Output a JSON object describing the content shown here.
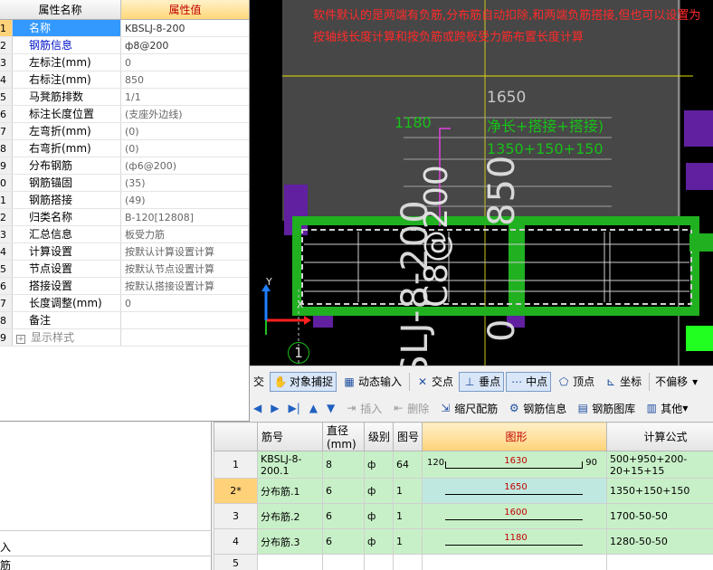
{
  "properties_panel": {
    "header_name": "属性名称",
    "header_value": "属性值",
    "rows": [
      {
        "num": "1",
        "name": "名称",
        "value": "KBSLJ-8-200",
        "style": "sel"
      },
      {
        "num": "2",
        "name": "钢筋信息",
        "value": "ф8@200",
        "style": "blue"
      },
      {
        "num": "3",
        "name": "左标注(mm)",
        "value": "0",
        "style": ""
      },
      {
        "num": "4",
        "name": "右标注(mm)",
        "value": "850",
        "style": ""
      },
      {
        "num": "5",
        "name": "马凳筋排数",
        "value": "1/1",
        "style": ""
      },
      {
        "num": "6",
        "name": "标注长度位置",
        "value": "(支座外边线)",
        "style": ""
      },
      {
        "num": "7",
        "name": "左弯折(mm)",
        "value": "(0)",
        "style": ""
      },
      {
        "num": "8",
        "name": "右弯折(mm)",
        "value": "(0)",
        "style": ""
      },
      {
        "num": "9",
        "name": "分布钢筋",
        "value": "(ф6@200)",
        "style": ""
      },
      {
        "num": "0",
        "name": "钢筋锚固",
        "value": "(35)",
        "style": ""
      },
      {
        "num": "1",
        "name": "钢筋搭接",
        "value": "(49)",
        "style": ""
      },
      {
        "num": "2",
        "name": "归类名称",
        "value": "B-120[12808]",
        "style": ""
      },
      {
        "num": "3",
        "name": "汇总信息",
        "value": "板受力筋",
        "style": ""
      },
      {
        "num": "4",
        "name": "计算设置",
        "value": "按默认计算设置计算",
        "style": ""
      },
      {
        "num": "5",
        "name": "节点设置",
        "value": "按默认节点设置计算",
        "style": ""
      },
      {
        "num": "6",
        "name": "搭接设置",
        "value": "按默认搭接设置计算",
        "style": ""
      },
      {
        "num": "7",
        "name": "长度调整(mm)",
        "value": "0",
        "style": ""
      },
      {
        "num": "8",
        "name": "备注",
        "value": "",
        "style": ""
      },
      {
        "num": "9",
        "name": "显示样式",
        "value": "",
        "style": "collapse"
      }
    ]
  },
  "cad": {
    "note": "软件默认的是两端有负筋,分布筋自动扣除,和两端负筋搭接,但也可以设置为按轴线长度计算和按负筋或跨板受力筋布置长度计算",
    "dim_top": "1650",
    "green_label_left": "1180",
    "green_label_1": "净长+搭接+搭接)",
    "green_label_2": "1350+150+150",
    "vertical_text_1": "SLJ-8-200",
    "vertical_text_2": "C8@200",
    "vertical_text_3": "850",
    "vertical_text_4": "0",
    "axis_number": "1",
    "axis_x": "X",
    "axis_y": "Y"
  },
  "toolbar1": {
    "cut_label": "交",
    "snap_label": "对象捕捉",
    "dynamic_label": "动态输入",
    "intersect_label": "交点",
    "perp_label": "垂点",
    "mid_label": "中点",
    "vertex_label": "顶点",
    "coord_label": "坐标",
    "offset_label": "不偏移"
  },
  "toolbar2": {
    "insert_label": "插入",
    "delete_label": "删除",
    "scale_label": "缩尺配筋",
    "info_label": "钢筋信息",
    "library_label": "钢筋图库",
    "other_label": "其他"
  },
  "rebar_table": {
    "headers": {
      "no": "筋号",
      "dia": "直径(mm)",
      "grade": "级别",
      "fig": "图号",
      "shape": "图形",
      "formula": "计算公式"
    },
    "rows": [
      {
        "row": "1",
        "no": "KBSLJ-8-200.1",
        "dia": "8",
        "grade": "ф",
        "fig": "64",
        "left": "120",
        "value": "1630",
        "right": "90",
        "formula": "500+950+200-20+15+15",
        "hooks": true
      },
      {
        "row": "2*",
        "no": "分布筋.1",
        "dia": "6",
        "grade": "ф",
        "fig": "1",
        "left": "",
        "value": "1650",
        "right": "",
        "formula": "1350+150+150",
        "hooks": false
      },
      {
        "row": "3",
        "no": "分布筋.2",
        "dia": "6",
        "grade": "ф",
        "fig": "1",
        "left": "",
        "value": "1600",
        "right": "",
        "formula": "1700-50-50",
        "hooks": false
      },
      {
        "row": "4",
        "no": "分布筋.3",
        "dia": "6",
        "grade": "ф",
        "fig": "1",
        "left": "",
        "value": "1180",
        "right": "",
        "formula": "1280-50-50",
        "hooks": false
      },
      {
        "row": "5",
        "no": "",
        "dia": "",
        "grade": "",
        "fig": "",
        "left": "",
        "value": "",
        "right": "",
        "formula": "",
        "hooks": false
      }
    ]
  },
  "left_bottom": {
    "label_1": "入",
    "label_2": "筋"
  }
}
